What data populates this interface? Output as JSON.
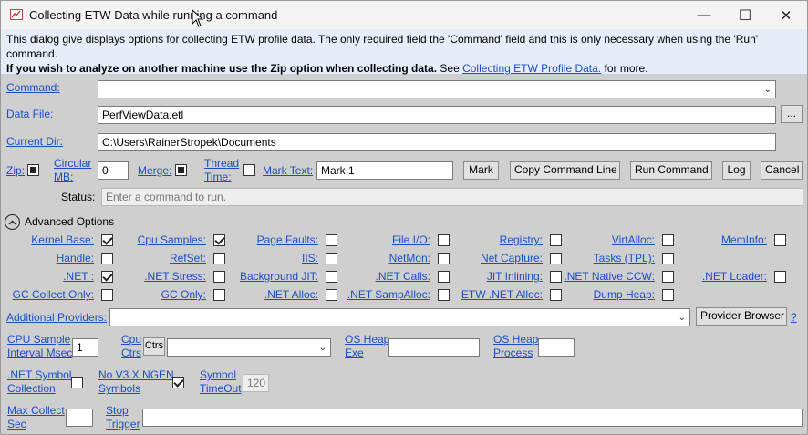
{
  "window": {
    "title": "Collecting ETW Data while running a command",
    "minimize": "—",
    "maximize": "☐",
    "close": "✕"
  },
  "info": {
    "line1": "This dialog give displays options for collecting ETW profile data. The only required field the 'Command' field and this is only necessary when using the 'Run' command.",
    "bold": "If you wish to analyze on another machine use the Zip option when collecting data.",
    "see": " See ",
    "link": "Collecting ETW Profile Data.",
    "more": " for more."
  },
  "form": {
    "command_label": "Command:",
    "command_value": "",
    "datafile_label": "Data File:",
    "datafile_value": "PerfViewData.etl",
    "browse_label": "...",
    "curdir_label": "Current Dir:",
    "curdir_value": "C:\\Users\\RainerStropek\\Documents",
    "zip_label": "Zip:",
    "circular_label1": "Circular",
    "circular_label2": "MB:",
    "circular_value": "0",
    "merge_label": "Merge:",
    "thread_label1": "Thread",
    "thread_label2": "Time:",
    "marktext_label": "Mark Text:",
    "marktext_value": "Mark 1",
    "mark_btn": "Mark",
    "copy_btn": "Copy Command Line",
    "run_btn": "Run Command",
    "log_btn": "Log",
    "cancel_btn": "Cancel",
    "status_label": "Status:",
    "status_value": "Enter a command to run."
  },
  "advanced": {
    "toggle_glyph": "^",
    "label": "Advanced Options",
    "checks": [
      [
        "Kernel Base:",
        true
      ],
      [
        "Cpu Samples:",
        true
      ],
      [
        "Page Faults:",
        false
      ],
      [
        "File I/O:",
        false
      ],
      [
        "Registry:",
        false
      ],
      [
        "VirtAlloc:",
        false
      ],
      [
        "MemInfo:",
        false
      ],
      [
        "Handle:",
        false
      ],
      [
        "RefSet:",
        false
      ],
      [
        "IIS:",
        false
      ],
      [
        "NetMon:",
        false
      ],
      [
        "Net Capture:",
        false
      ],
      [
        "Tasks (TPL):",
        false
      ],
      [
        ".NET :",
        true
      ],
      [
        ".NET Stress:",
        false
      ],
      [
        "Background JIT:",
        false
      ],
      [
        ".NET Calls:",
        false
      ],
      [
        "JIT Inlining:",
        false
      ],
      [
        ".NET Native CCW:",
        false
      ],
      [
        ".NET Loader:",
        false
      ],
      [
        "GC Collect Only:",
        false
      ],
      [
        "GC Only:",
        false
      ],
      [
        ".NET Alloc:",
        false
      ],
      [
        ".NET SampAlloc:",
        false
      ],
      [
        "ETW .NET Alloc:",
        false
      ],
      [
        "Dump Heap:",
        false
      ]
    ],
    "providers_label": "Additional Providers:",
    "providers_value": "",
    "provider_browser_btn": "Provider Browser",
    "help": "?",
    "cpu_interval_label1": "CPU Sample",
    "cpu_interval_label2": "Interval Msec",
    "cpu_interval_value": "1",
    "cpu_ctrs_label1": "Cpu",
    "cpu_ctrs_label2": "Ctrs",
    "ctrs_btn": "Ctrs",
    "cpu_ctrs_value": "",
    "os_heap_exe_label1": "OS Heap",
    "os_heap_exe_label2": "Exe",
    "os_heap_exe_value": "",
    "os_heap_proc_label1": "OS Heap",
    "os_heap_proc_label2": "Process",
    "os_heap_proc_value": "",
    "net_symbol_label1": ".NET Symbol",
    "net_symbol_label2": "Collection",
    "ngen_label1": "No V3.X NGEN",
    "ngen_label2": "Symbols",
    "symbol_timeout_label1": "Symbol",
    "symbol_timeout_label2": "TimeOut",
    "symbol_timeout_value": "120",
    "max_collect_label1": "Max Collect",
    "max_collect_label2": "Sec",
    "max_collect_value": "",
    "stop_trigger_label1": "Stop",
    "stop_trigger_label2": "Trigger",
    "stop_trigger_value": ""
  }
}
